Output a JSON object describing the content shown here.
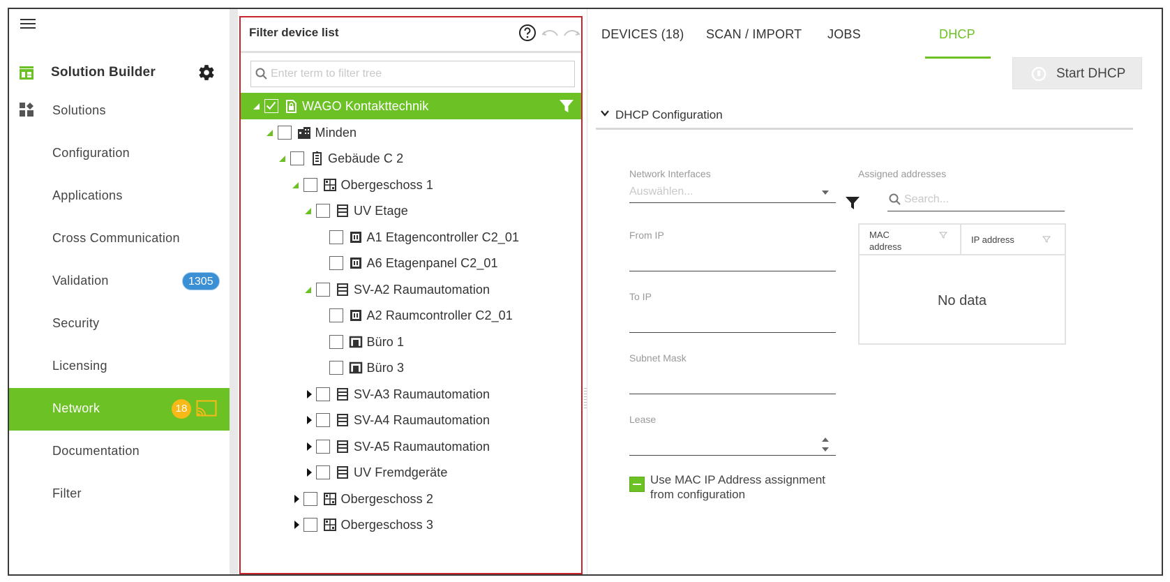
{
  "sidebar": {
    "app_title": "Solution Builder",
    "items": [
      {
        "label": "Solutions"
      },
      {
        "label": "Configuration"
      },
      {
        "label": "Applications"
      },
      {
        "label": "Cross Communication"
      },
      {
        "label": "Validation",
        "badge": "1305"
      },
      {
        "label": "Security"
      },
      {
        "label": "Licensing"
      },
      {
        "label": "Network",
        "badge": "18",
        "active": true
      },
      {
        "label": "Documentation"
      },
      {
        "label": "Filter"
      }
    ],
    "active_color": "#6cc224"
  },
  "tree": {
    "title": "Filter device list",
    "search_placeholder": "Enter term to filter tree",
    "nodes": [
      {
        "label": "WAGO Kontakttechnik",
        "icon": "lock-file-icon",
        "expanded": true,
        "checked": true
      },
      {
        "label": "Minden",
        "icon": "building-icon",
        "expanded": true
      },
      {
        "label": "Gebäude C 2",
        "icon": "building-floors-icon",
        "expanded": true
      },
      {
        "label": "Obergeschoss 1",
        "icon": "floor-plan-icon",
        "expanded": true
      },
      {
        "label": "UV Etage",
        "icon": "cabinet-icon",
        "expanded": true
      },
      {
        "label": "A1 Etagencontroller C2_01",
        "icon": "controller-icon"
      },
      {
        "label": "A6 Etagenpanel C2_01",
        "icon": "controller-icon"
      },
      {
        "label": "SV-A2 Raumautomation",
        "icon": "cabinet-icon",
        "expanded": true
      },
      {
        "label": "A2 Raumcontroller C2_01",
        "icon": "controller-icon"
      },
      {
        "label": "Büro 1",
        "icon": "room-icon"
      },
      {
        "label": "Büro 3",
        "icon": "room-icon"
      },
      {
        "label": "SV-A3 Raumautomation",
        "icon": "cabinet-icon",
        "expanded": false
      },
      {
        "label": "SV-A4 Raumautomation",
        "icon": "cabinet-icon",
        "expanded": false
      },
      {
        "label": "SV-A5 Raumautomation",
        "icon": "cabinet-icon",
        "expanded": false
      },
      {
        "label": "UV Fremdgeräte",
        "icon": "cabinet-icon",
        "expanded": false
      },
      {
        "label": "Obergeschoss 2",
        "icon": "floor-plan-icon",
        "expanded": false
      },
      {
        "label": "Obergeschoss 3",
        "icon": "floor-plan-icon",
        "expanded": false
      }
    ]
  },
  "tabs": [
    {
      "label": "DEVICES (18)"
    },
    {
      "label": "SCAN / IMPORT"
    },
    {
      "label": "JOBS"
    },
    {
      "label": "DHCP",
      "active": true
    }
  ],
  "dhcp": {
    "start_button": "Start DHCP",
    "section_title": "DHCP Configuration",
    "network_interfaces_label": "Network Interfaces",
    "network_interfaces_placeholder": "Auswählen...",
    "from_ip_label": "From IP",
    "to_ip_label": "To IP",
    "subnet_mask_label": "Subnet Mask",
    "lease_label": "Lease",
    "mac_assignment_label": "Use MAC IP Address assignment from configuration",
    "assigned_label": "Assigned addresses",
    "search_placeholder": "Search...",
    "columns": [
      "MAC address",
      "IP address"
    ],
    "empty_text": "No data"
  }
}
